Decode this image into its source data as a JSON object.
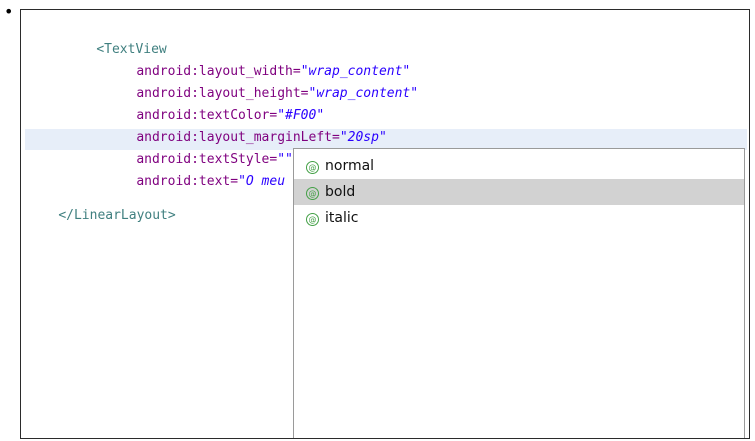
{
  "bullet": "•",
  "code": {
    "line1": {
      "tag": "<TextView"
    },
    "line2": {
      "attr": "android:layout_width=",
      "value": "\"wrap_content\""
    },
    "line3": {
      "attr": "android:layout_height=",
      "value": "\"wrap_content\""
    },
    "line4": {
      "attr": "android:textColor=",
      "value": "\"#F00\""
    },
    "line5": {
      "attr": "android:layout_marginLeft=",
      "value": "\"20sp\""
    },
    "line6": {
      "attr": "android:textStyle=",
      "value": "\"\""
    },
    "line7": {
      "attr": "android:text=",
      "value": "\"O meu"
    },
    "line8": {
      "tag": "</LinearLayout>"
    }
  },
  "autocomplete": {
    "icon_glyph": "@",
    "items": [
      {
        "label": "normal",
        "selected": false
      },
      {
        "label": "bold",
        "selected": true
      },
      {
        "label": "italic",
        "selected": false
      }
    ]
  },
  "colors": {
    "tag": "#3f7f7f",
    "attribute": "#7f007f",
    "string": "#2a00ff",
    "current_line": "#e7eef9",
    "selection": "#d2d2d2",
    "icon": "#44a047"
  }
}
